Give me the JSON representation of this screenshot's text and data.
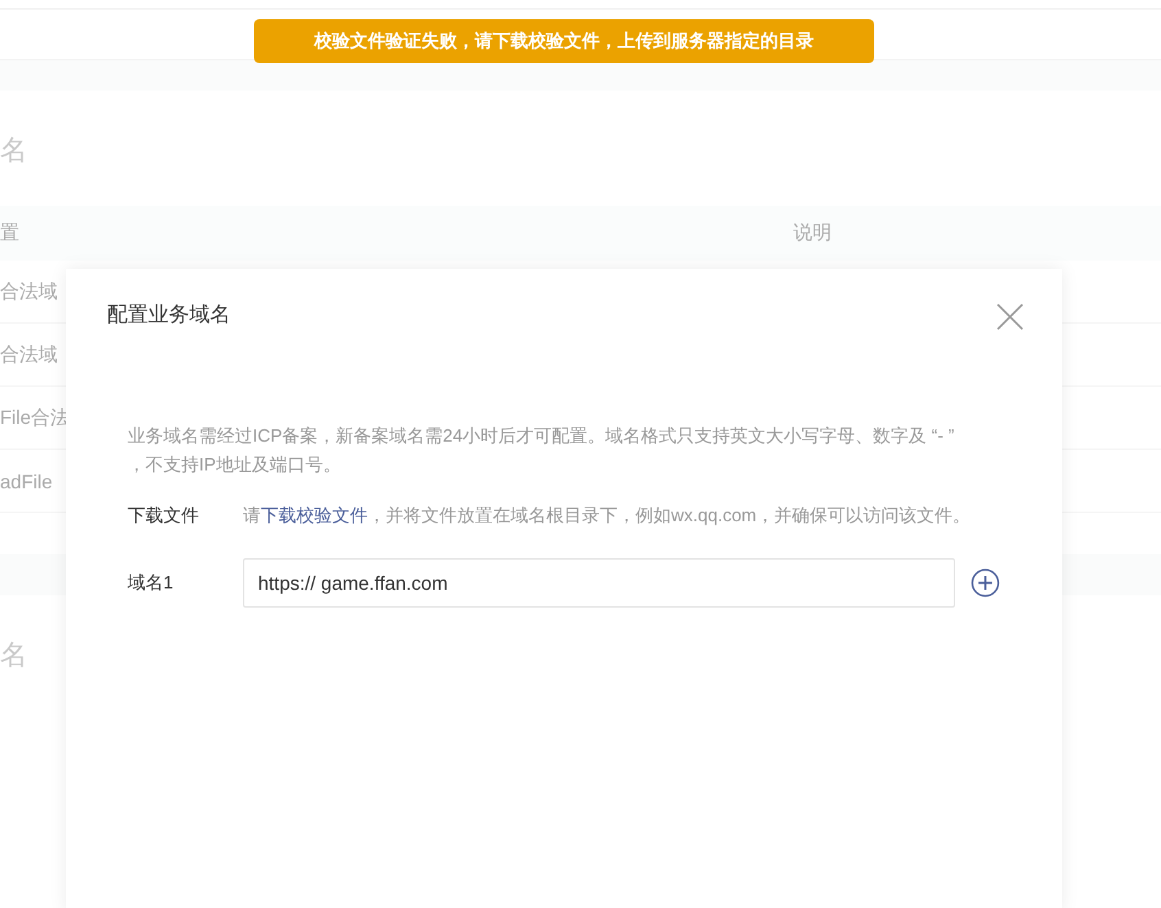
{
  "toast": {
    "text": "校验文件验证失败，请下载校验文件，上传到服务器指定的目录"
  },
  "background": {
    "heading": "名",
    "columns": [
      "置",
      "说明"
    ],
    "rows": [
      "合法域",
      "合法域",
      "File合法",
      "adFile"
    ],
    "heading_2": "名"
  },
  "dialog": {
    "title": "配置业务域名",
    "notice": "业务域名需经过ICP备案，新备案域名需24小时后才可配置。域名格式只支持英文大小写字母、数字及 “- ” ，不支持IP地址及端口号。",
    "download": {
      "label": "下载文件",
      "before": "请",
      "link": "下载校验文件",
      "after": "，并将文件放置在域名根目录下，例如wx.qq.com，并确保可以访问该文件。"
    },
    "fields": [
      {
        "label": "域名1",
        "value": "https:// game.ffan.com"
      }
    ]
  }
}
